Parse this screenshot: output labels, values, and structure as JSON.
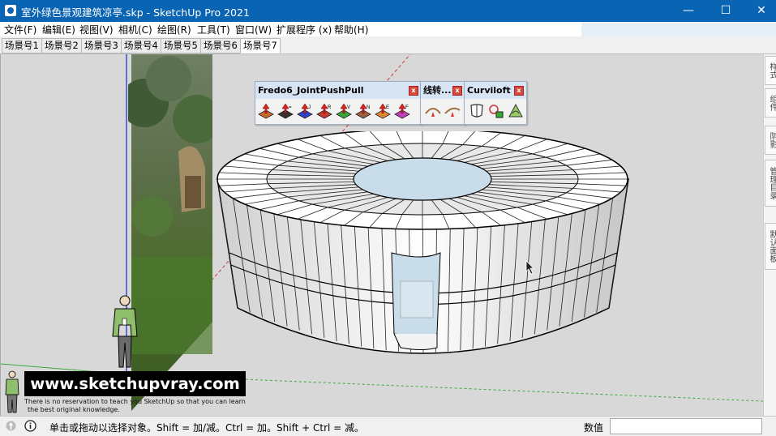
{
  "window": {
    "title": "室外绿色景观建筑凉亭.skp - SketchUp Pro 2021",
    "minimize_glyph": "—",
    "maximize_glyph": "☐",
    "close_glyph": "✕"
  },
  "menu": [
    "文件(F)",
    "编辑(E)",
    "视图(V)",
    "相机(C)",
    "绘图(R)",
    "工具(T)",
    "窗口(W)",
    "扩展程序 (x)",
    "帮助(H)"
  ],
  "scene_tabs": [
    "场景号1",
    "场景号2",
    "场景号3",
    "场景号4",
    "场景号5",
    "场景号6",
    "场景号7"
  ],
  "active_scene": "场景号7",
  "toolbars": {
    "fredo": {
      "title": "Fredo6_JointPushPull",
      "icon_labels": [
        "",
        "=",
        "J",
        "R",
        "V",
        "N",
        "E",
        "F"
      ]
    },
    "xianzhuan": {
      "title": "线转..."
    },
    "curviloft": {
      "title": "Curviloft"
    },
    "close_glyph": "x"
  },
  "right_panels": [
    "样式",
    "组件",
    "阴影",
    "管理目录",
    "默认面板"
  ],
  "watermark": {
    "url": "www.sketchupvray.com",
    "line1": "There is no reservation to teach you SketchUp so that you can learn",
    "line2": "the best original knowledge."
  },
  "status": {
    "hint": "单击或拖动以选择对象。Shift = 加/减。Ctrl = 加。Shift + Ctrl = 减。",
    "measurement_label": "数值",
    "measurement_value": ""
  },
  "colors": {
    "titlebar": "#0a64b4",
    "viewport_bg": "#d8d8d8",
    "model_face": "#ffffff",
    "glass": "#c9dcea",
    "axis_red": "#d23a3a",
    "axis_green": "#3aa83a",
    "axis_blue": "#3a4ad2"
  }
}
